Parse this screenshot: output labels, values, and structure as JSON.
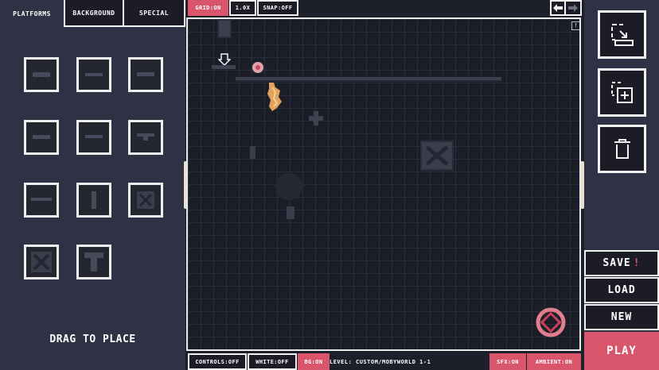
{
  "palette": {
    "tabs": [
      "PLATFORMS",
      "BACKGROUND",
      "SPECIAL"
    ],
    "active_tab": "PLATFORMS",
    "drag_hint": "DRAG TO PLACE",
    "tiles": [
      "platform-tile",
      "platform-tile",
      "platform-tile",
      "platform-tile",
      "platform-tile",
      "platform-tile",
      "platform-tile",
      "platform-tile",
      "crate-tile",
      "crate-tile",
      "t-block-tile"
    ]
  },
  "toolbar": {
    "grid": "GRID:ON",
    "zoom": "1.0X",
    "snap": "SNAP:OFF",
    "undo_icon": "arrow-left-icon",
    "redo_icon": "arrow-right-icon"
  },
  "canvas": {
    "info_badge": "!",
    "background_color": "#1b1d27",
    "grid_color": "#2a2d3a"
  },
  "bottom": {
    "controls": "CONTROLS:OFF",
    "white": "WHITE:OFF",
    "bg": "BG:ON",
    "level": "LEVEL: CUSTOM/MOBYWORLD 1-1",
    "sfx": "SFX:ON",
    "ambient": "AMBIENT:ON"
  },
  "side": {
    "tools": [
      "select-area-icon",
      "duplicate-icon",
      "trash-icon"
    ],
    "save": "SAVE",
    "save_flag": "!",
    "load": "LOAD",
    "new": "NEW",
    "play": "PLAY"
  },
  "colors": {
    "accent": "#d8556c",
    "panel": "#2f3244",
    "button": "#1b1c26",
    "outline": "#f2f2f2"
  }
}
